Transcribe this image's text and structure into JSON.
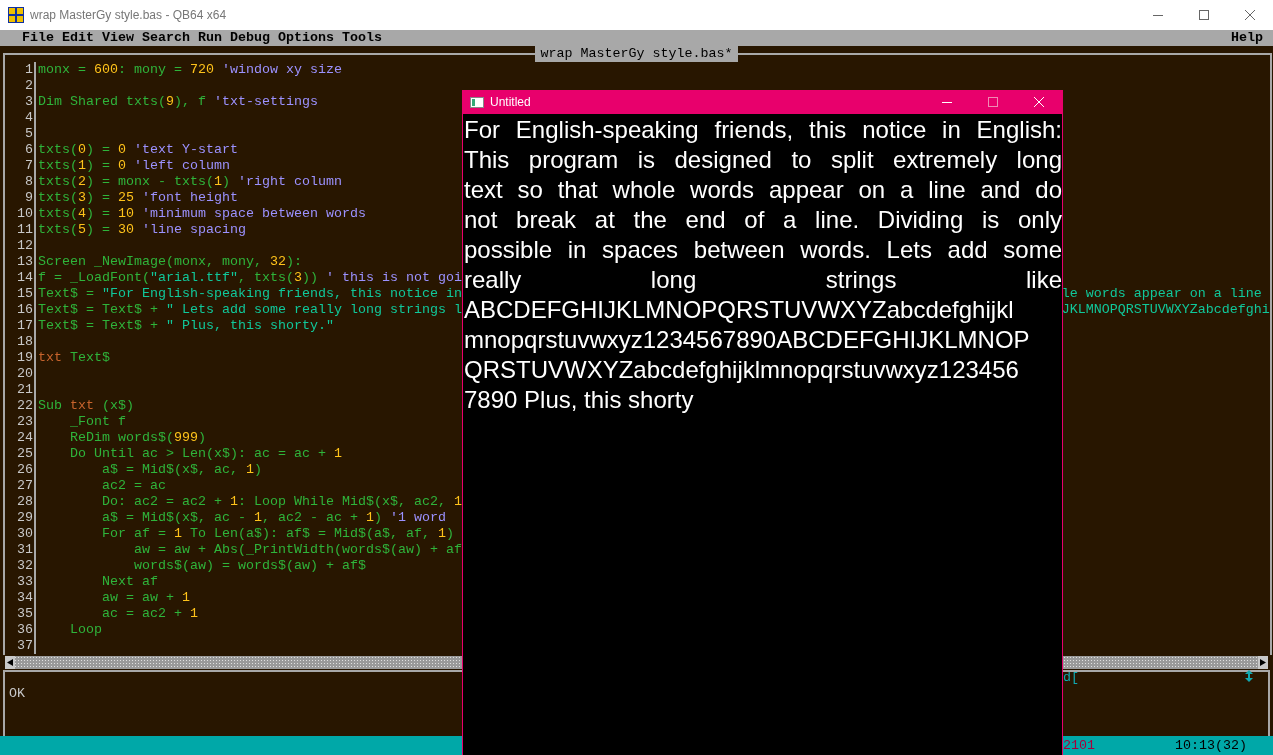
{
  "window": {
    "title": "wrap MasterGy style.bas - QB64 x64"
  },
  "menu": {
    "items": [
      "File",
      "Edit",
      "View",
      "Search",
      "Run",
      "Debug",
      "Options",
      "Tools"
    ],
    "help": "Help"
  },
  "editor": {
    "file_tab": "wrap MasterGy style.bas*",
    "lines": [
      {
        "number": "1",
        "segments": [
          {
            "text": "monx = ",
            "kind": "code"
          },
          {
            "text": "600",
            "kind": "number"
          },
          {
            "text": ": mony = ",
            "kind": "code"
          },
          {
            "text": "720",
            "kind": "number"
          },
          {
            "text": " 'window xy size",
            "kind": "comment"
          }
        ]
      },
      {
        "number": "2"
      },
      {
        "number": "3",
        "segments": [
          {
            "text": "Dim Shared txts(",
            "kind": "code"
          },
          {
            "text": "9",
            "kind": "number"
          },
          {
            "text": "), f ",
            "kind": "code"
          },
          {
            "text": "'txt-settings",
            "kind": "comment"
          }
        ]
      },
      {
        "number": "4"
      },
      {
        "number": "5"
      },
      {
        "number": "6",
        "segments": [
          {
            "text": "txts(",
            "kind": "code"
          },
          {
            "text": "0",
            "kind": "number"
          },
          {
            "text": ") = ",
            "kind": "code"
          },
          {
            "text": "0",
            "kind": "number"
          },
          {
            "text": " 'text Y-start",
            "kind": "comment"
          }
        ]
      },
      {
        "number": "7",
        "segments": [
          {
            "text": "txts(",
            "kind": "code"
          },
          {
            "text": "1",
            "kind": "number"
          },
          {
            "text": ") = ",
            "kind": "code"
          },
          {
            "text": "0",
            "kind": "number"
          },
          {
            "text": " 'left column",
            "kind": "comment"
          }
        ]
      },
      {
        "number": "8",
        "segments": [
          {
            "text": "txts(",
            "kind": "code"
          },
          {
            "text": "2",
            "kind": "number"
          },
          {
            "text": ") = monx - txts(",
            "kind": "code"
          },
          {
            "text": "1",
            "kind": "number"
          },
          {
            "text": ") ",
            "kind": "code"
          },
          {
            "text": "'right column",
            "kind": "comment"
          }
        ]
      },
      {
        "number": "9",
        "segments": [
          {
            "text": "txts(",
            "kind": "code"
          },
          {
            "text": "3",
            "kind": "number"
          },
          {
            "text": ") = ",
            "kind": "code"
          },
          {
            "text": "25",
            "kind": "number"
          },
          {
            "text": " 'font height",
            "kind": "comment"
          }
        ]
      },
      {
        "number": "10",
        "segments": [
          {
            "text": "txts(",
            "kind": "code"
          },
          {
            "text": "4",
            "kind": "number"
          },
          {
            "text": ") = ",
            "kind": "code"
          },
          {
            "text": "10",
            "kind": "number"
          },
          {
            "text": " 'minimum space between words",
            "kind": "comment"
          }
        ]
      },
      {
        "number": "11",
        "segments": [
          {
            "text": "txts(",
            "kind": "code"
          },
          {
            "text": "5",
            "kind": "number"
          },
          {
            "text": ") = ",
            "kind": "code"
          },
          {
            "text": "30",
            "kind": "number"
          },
          {
            "text": " 'line spacing",
            "kind": "comment"
          }
        ]
      },
      {
        "number": "12"
      },
      {
        "number": "13",
        "segments": [
          {
            "text": "Screen _NewImage(monx, mony, ",
            "kind": "code"
          },
          {
            "text": "32",
            "kind": "number"
          },
          {
            "text": "):",
            "kind": "code"
          }
        ]
      },
      {
        "number": "14",
        "segments": [
          {
            "text": "f = _LoadFont(",
            "kind": "code"
          },
          {
            "text": "\"arial.ttf\"",
            "kind": "string"
          },
          {
            "text": ", txts(",
            "kind": "code"
          },
          {
            "text": "3",
            "kind": "number"
          },
          {
            "text": ")) ",
            "kind": "code"
          },
          {
            "text": "' this is not goi",
            "kind": "comment"
          }
        ]
      },
      {
        "number": "15",
        "segments": [
          {
            "text": "Text$ = ",
            "kind": "code"
          },
          {
            "text": "\"For English-speaking friends, this notice in",
            "kind": "string"
          }
        ],
        "tail": {
          "text": "le words appear on a line",
          "kind": "string"
        }
      },
      {
        "number": "16",
        "segments": [
          {
            "text": "Text$ = Text$ + ",
            "kind": "code"
          },
          {
            "text": "\" Lets add some really long strings l",
            "kind": "string"
          }
        ],
        "tail": {
          "text": "JKLMNOPQRSTUVWXYZabcdefghi",
          "kind": "string"
        }
      },
      {
        "number": "17",
        "segments": [
          {
            "text": "Text$ = Text$ + ",
            "kind": "code"
          },
          {
            "text": "\" Plus, this shorty.\"",
            "kind": "string"
          }
        ]
      },
      {
        "number": "18"
      },
      {
        "number": "19",
        "segments": [
          {
            "text": "txt",
            "kind": "sub"
          },
          {
            "text": " Text$",
            "kind": "code"
          }
        ]
      },
      {
        "number": "20"
      },
      {
        "number": "21"
      },
      {
        "number": "22",
        "segments": [
          {
            "text": "Sub ",
            "kind": "code"
          },
          {
            "text": "txt",
            "kind": "sub"
          },
          {
            "text": " (x$)",
            "kind": "code"
          }
        ]
      },
      {
        "number": "23",
        "segments": [
          {
            "text": "    _Font f",
            "kind": "code"
          }
        ]
      },
      {
        "number": "24",
        "segments": [
          {
            "text": "    ReDim words$(",
            "kind": "code"
          },
          {
            "text": "999",
            "kind": "number"
          },
          {
            "text": ")",
            "kind": "code"
          }
        ]
      },
      {
        "number": "25",
        "segments": [
          {
            "text": "    Do Until ac > Len(x$): ac = ac + ",
            "kind": "code"
          },
          {
            "text": "1",
            "kind": "number"
          }
        ]
      },
      {
        "number": "26",
        "segments": [
          {
            "text": "        a$ = Mid$(x$, ac, ",
            "kind": "code"
          },
          {
            "text": "1",
            "kind": "number"
          },
          {
            "text": ")",
            "kind": "code"
          }
        ]
      },
      {
        "number": "27",
        "segments": [
          {
            "text": "        ac2 = ac",
            "kind": "code"
          }
        ]
      },
      {
        "number": "28",
        "segments": [
          {
            "text": "        Do: ac2 = ac2 + ",
            "kind": "code"
          },
          {
            "text": "1",
            "kind": "number"
          },
          {
            "text": ": Loop While Mid$(x$, ac2, ",
            "kind": "code"
          },
          {
            "text": "1",
            "kind": "number"
          }
        ]
      },
      {
        "number": "29",
        "segments": [
          {
            "text": "        a$ = Mid$(x$, ac - ",
            "kind": "code"
          },
          {
            "text": "1",
            "kind": "number"
          },
          {
            "text": ", ac2 - ac + ",
            "kind": "code"
          },
          {
            "text": "1",
            "kind": "number"
          },
          {
            "text": ") ",
            "kind": "code"
          },
          {
            "text": "'1 word",
            "kind": "comment"
          }
        ]
      },
      {
        "number": "30",
        "segments": [
          {
            "text": "        For af = ",
            "kind": "code"
          },
          {
            "text": "1",
            "kind": "number"
          },
          {
            "text": " To Len(a$): af$ = Mid$(a$, af, ",
            "kind": "code"
          },
          {
            "text": "1",
            "kind": "number"
          },
          {
            "text": ")",
            "kind": "code"
          }
        ]
      },
      {
        "number": "31",
        "segments": [
          {
            "text": "            aw = aw + Abs(_PrintWidth(words$(aw) + af",
            "kind": "code"
          }
        ]
      },
      {
        "number": "32",
        "segments": [
          {
            "text": "            words$(aw) = words$(aw) + af$",
            "kind": "code"
          }
        ]
      },
      {
        "number": "33",
        "segments": [
          {
            "text": "        Next af",
            "kind": "code"
          }
        ]
      },
      {
        "number": "34",
        "segments": [
          {
            "text": "        aw = aw + ",
            "kind": "code"
          },
          {
            "text": "1",
            "kind": "number"
          }
        ]
      },
      {
        "number": "35",
        "segments": [
          {
            "text": "        ac = ac2 + ",
            "kind": "code"
          },
          {
            "text": "1",
            "kind": "number"
          }
        ]
      },
      {
        "number": "36",
        "segments": [
          {
            "text": "    Loop",
            "kind": "code"
          }
        ]
      },
      {
        "number": "37"
      }
    ]
  },
  "status": {
    "message": "OK",
    "search_text": "d[",
    "line_info": "2101",
    "cursor": "10:13(32)"
  },
  "output_window": {
    "title": "Untitled",
    "lines": [
      {
        "text": "For English-speaking friends, this notice in English:",
        "justified": true
      },
      {
        "text": "This program is designed to split extremely long",
        "justified": true
      },
      {
        "text": "text so that whole words appear on a line and do",
        "justified": true
      },
      {
        "text": "not break at the end of a line. Dividing is only",
        "justified": true
      },
      {
        "text": "possible in spaces between words. Lets add some",
        "justified": true
      },
      {
        "text": "really long strings like",
        "justified": true
      },
      {
        "text": "ABCDEFGHIJKLMNOPQRSTUVWXYZabcdefghijkl"
      },
      {
        "text": "mnopqrstuvwxyz1234567890ABCDEFGHIJKLMNOP"
      },
      {
        "text": "QRSTUVWXYZabcdefghijklmnopqrstuvwxyz123456"
      },
      {
        "text": "7890 Plus, this shorty",
        "justified": false
      }
    ]
  }
}
